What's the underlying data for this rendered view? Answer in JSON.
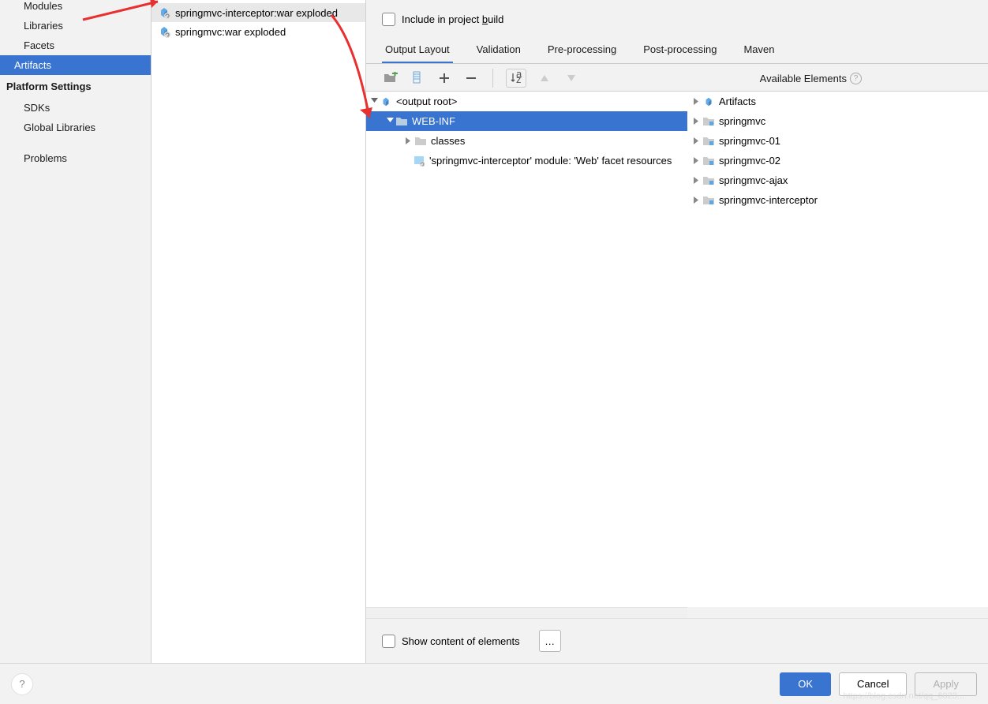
{
  "sidebar": {
    "items": [
      {
        "label": "Modules",
        "selected": false
      },
      {
        "label": "Libraries",
        "selected": false
      },
      {
        "label": "Facets",
        "selected": false
      },
      {
        "label": "Artifacts",
        "selected": true
      }
    ],
    "platform_heading": "Platform Settings",
    "platform_items": [
      {
        "label": "SDKs"
      },
      {
        "label": "Global Libraries"
      }
    ],
    "problems_label": "Problems"
  },
  "artifacts": [
    {
      "label": "springmvc-interceptor:war exploded",
      "selected": true
    },
    {
      "label": "springmvc:war exploded",
      "selected": false
    }
  ],
  "top": {
    "include_label": "Include in project build",
    "underline_char": "b"
  },
  "tabs": [
    {
      "label": "Output Layout",
      "active": true
    },
    {
      "label": "Validation"
    },
    {
      "label": "Pre-processing"
    },
    {
      "label": "Post-processing"
    },
    {
      "label": "Maven"
    }
  ],
  "toolbar": {
    "avail_label": "Available Elements"
  },
  "output_tree": {
    "root_label": "<output root>",
    "webinf_label": "WEB-INF",
    "classes_label": "classes",
    "facet_label": "'springmvc-interceptor' module: 'Web' facet resources"
  },
  "avail_tree": {
    "root_label": "Artifacts",
    "items": [
      "springmvc",
      "springmvc-01",
      "springmvc-02",
      "springmvc-ajax",
      "springmvc-interceptor"
    ]
  },
  "bottom": {
    "show_content_label": "Show content of elements",
    "ellipsis": "…"
  },
  "footer": {
    "ok": "OK",
    "cancel": "Cancel",
    "apply": "Apply"
  },
  "watermark": "https://blog.csdn.net/qq_6023..."
}
